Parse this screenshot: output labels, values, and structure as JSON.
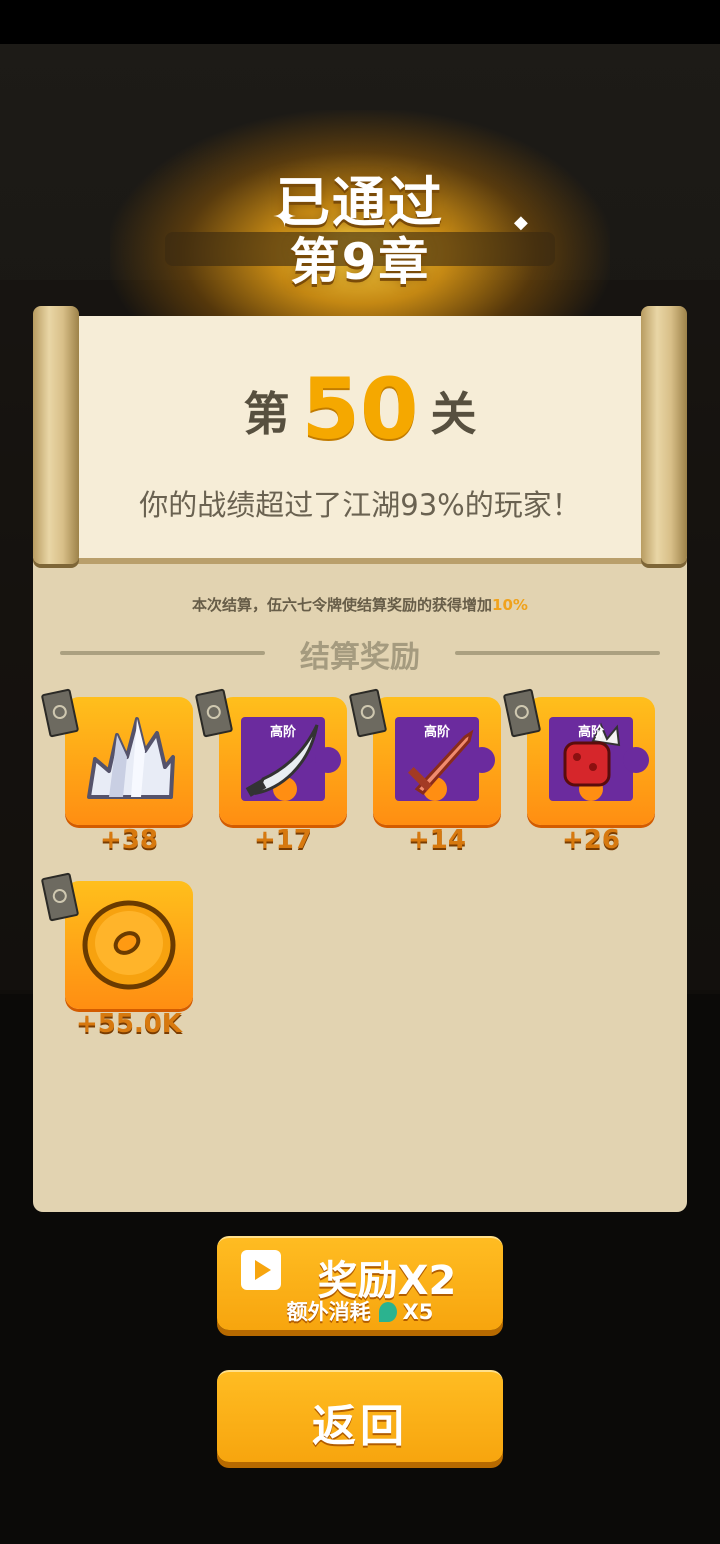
{
  "header": {
    "title_line1": "已通过",
    "title_line2": "第9章"
  },
  "scroll": {
    "level_prefix": "第",
    "level_number": "50",
    "level_suffix": "关",
    "rank_text": "你的战绩超过了江湖93%的玩家！"
  },
  "settlement": {
    "note_text": "本次结算，伍六七令牌使结算奖励的获得增加",
    "note_percent": "10%",
    "section_title": "结算奖励"
  },
  "rewards": [
    {
      "icon": "crystal-icon",
      "quantity": "+38"
    },
    {
      "icon": "saber-fragment-icon",
      "grade": "高阶",
      "quantity": "+17"
    },
    {
      "icon": "sword-fragment-icon",
      "grade": "高阶",
      "quantity": "+14"
    },
    {
      "icon": "glove-fragment-icon",
      "grade": "高阶",
      "quantity": "+26"
    },
    {
      "icon": "coin-icon",
      "quantity": "+55.0K"
    }
  ],
  "buttons": {
    "double_label": "奖励X2",
    "double_extra_label": "额外消耗",
    "double_cost": "X5",
    "back_label": "返回"
  },
  "colors": {
    "accent": "#F7A50E",
    "level_number": "#F5A800",
    "card_gradient_top": "#FFBF1C",
    "card_gradient_bottom": "#FF8E12"
  }
}
